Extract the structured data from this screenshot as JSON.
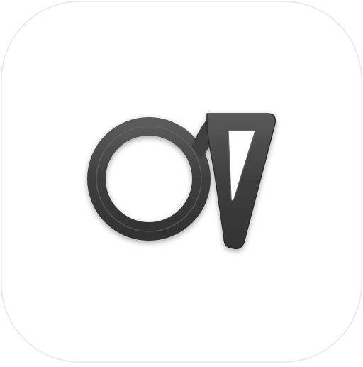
{
  "icon": {
    "name": "app-icon",
    "glyph": "ring-and-triangle-logo-icon"
  },
  "colors": {
    "page_background": "#ffffff",
    "tile_fill": "#ffffff",
    "tile_border": "#ececec",
    "glyph_stroke": "#3f3f3f",
    "glyph_stroke_highlight": "#6a6a6a",
    "glyph_inner_fill": "#ffffff"
  }
}
